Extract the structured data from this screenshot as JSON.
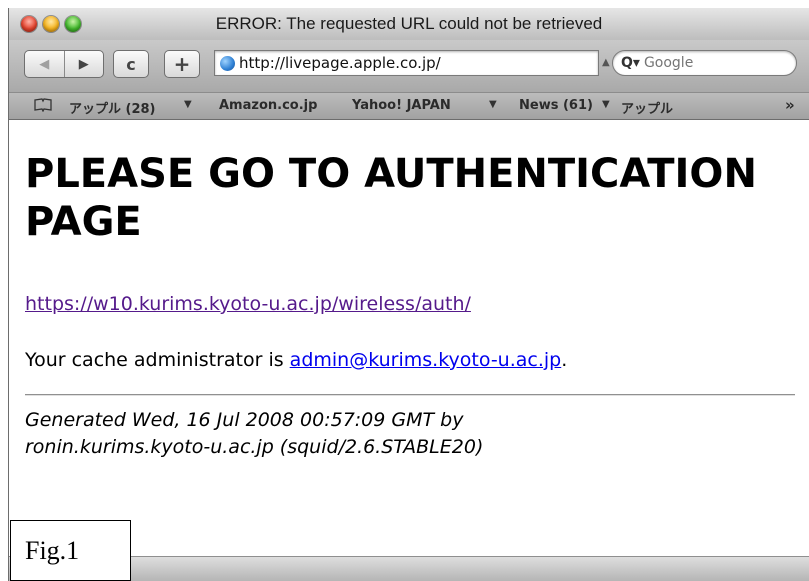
{
  "window": {
    "title": "ERROR: The requested URL could not be retrieved"
  },
  "toolbar": {
    "back_glyph": "◀",
    "forward_glyph": "▶",
    "reload_glyph": "c",
    "add_bookmark_glyph": "+",
    "url": "http://livepage.apple.co.jp/",
    "search_placeholder": "Google"
  },
  "bookmarks": {
    "items": [
      {
        "label": "アップル (28)",
        "has_menu": true
      },
      {
        "label": "Amazon.co.jp",
        "has_menu": false
      },
      {
        "label": "Yahoo! JAPAN",
        "has_menu": true
      },
      {
        "label": "News (61)",
        "has_menu": true
      },
      {
        "label": "アップル",
        "has_menu": false
      }
    ],
    "overflow_glyph": "»"
  },
  "page": {
    "heading": "PLEASE GO TO AUTHENTICATION PAGE",
    "auth_link": "https://w10.kurims.kyoto-u.ac.jp/wireless/auth/",
    "cache_prefix": "Your cache administrator is ",
    "cache_email": "admin@kurims.kyoto-u.ac.jp",
    "cache_suffix": ".",
    "generated": "Generated Wed, 16 Jul 2008 00:57:09 GMT by ronin.kurims.kyoto-u.ac.jp (squid/2.6.STABLE20)"
  },
  "figure_label": "Fig.1"
}
